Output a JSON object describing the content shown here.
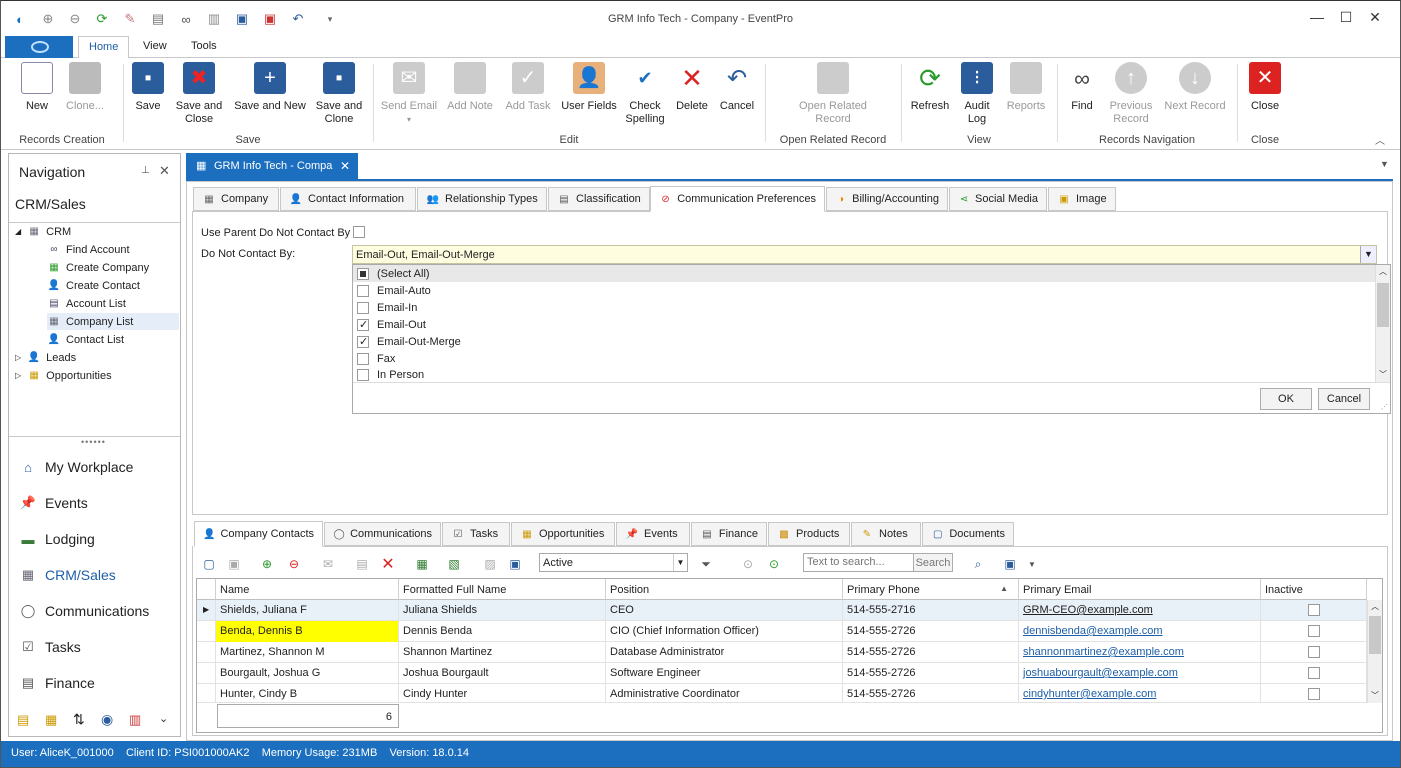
{
  "window": {
    "title": "GRM Info Tech - Company - EventPro"
  },
  "ribbon_tabs": [
    "Home",
    "View",
    "Tools"
  ],
  "ribbon": {
    "buttons": {
      "new": "New",
      "clone": "Clone...",
      "save": "Save",
      "save_close_1": "Save and",
      "save_close_2": "Close",
      "save_new": "Save and New",
      "save_clone_1": "Save and",
      "save_clone_2": "Clone",
      "send_email": "Send Email",
      "add_note": "Add Note",
      "add_task": "Add Task",
      "user_fields": "User Fields",
      "check_spelling_1": "Check",
      "check_spelling_2": "Spelling",
      "delete": "Delete",
      "cancel": "Cancel",
      "open_related_1": "Open Related",
      "open_related_2": "Record",
      "refresh": "Refresh",
      "audit_log_1": "Audit",
      "audit_log_2": "Log",
      "reports": "Reports",
      "find": "Find",
      "previous_1": "Previous",
      "previous_2": "Record",
      "next_record": "Next Record",
      "close": "Close"
    },
    "groups": {
      "records_creation": "Records Creation",
      "save": "Save",
      "edit": "Edit",
      "open_related": "Open Related Record",
      "view": "View",
      "records_navigation": "Records Navigation",
      "close": "Close"
    }
  },
  "navigation": {
    "header": "Navigation",
    "section": "CRM/Sales",
    "tree": {
      "crm": "CRM",
      "items": [
        "Find Account",
        "Create Company",
        "Create Contact",
        "Account List",
        "Company List",
        "Contact List"
      ],
      "leads": "Leads",
      "opportunities": "Opportunities"
    },
    "buttons": [
      "My Workplace",
      "Events",
      "Lodging",
      "CRM/Sales",
      "Communications",
      "Tasks",
      "Finance"
    ]
  },
  "document_tab": {
    "label": "GRM Info Tech - Compa"
  },
  "top_tabs": [
    "Company",
    "Contact Information",
    "Relationship Types",
    "Classification",
    "Communication Preferences",
    "Billing/Accounting",
    "Social Media",
    "Image"
  ],
  "form": {
    "use_parent_label": "Use Parent Do Not Contact By",
    "do_not_contact_label": "Do Not Contact By:",
    "do_not_contact_value": "Email-Out, Email-Out-Merge"
  },
  "dropdown": {
    "options": [
      {
        "label": "(Select All)",
        "state": "partial"
      },
      {
        "label": "Email-Auto",
        "state": "off"
      },
      {
        "label": "Email-In",
        "state": "off"
      },
      {
        "label": "Email-Out",
        "state": "on"
      },
      {
        "label": "Email-Out-Merge",
        "state": "on"
      },
      {
        "label": "Fax",
        "state": "off"
      },
      {
        "label": "In Person",
        "state": "off"
      }
    ],
    "ok": "OK",
    "cancel": "Cancel"
  },
  "bottom_tabs": [
    "Company Contacts",
    "Communications",
    "Tasks",
    "Opportunities",
    "Events",
    "Finance",
    "Products",
    "Notes",
    "Documents"
  ],
  "toolbar": {
    "filter_value": "Active",
    "search_placeholder": "Text to search...",
    "search_button": "Search"
  },
  "grid": {
    "columns": [
      "Name",
      "Formatted Full Name",
      "Position",
      "Primary Phone",
      "Primary Email",
      "Inactive"
    ],
    "rows": [
      {
        "name": "Shields, Juliana F",
        "full": "Juliana Shields",
        "position": "CEO",
        "phone": "514-555-2716",
        "email": "GRM-CEO@example.com"
      },
      {
        "name": "Benda, Dennis B",
        "full": "Dennis Benda",
        "position": "CIO (Chief Information Officer)",
        "phone": "514-555-2726",
        "email": "dennisbenda@example.com"
      },
      {
        "name": "Martinez, Shannon M",
        "full": "Shannon Martinez",
        "position": "Database Administrator",
        "phone": "514-555-2726",
        "email": "shannonmartinez@example.com"
      },
      {
        "name": "Bourgault, Joshua G",
        "full": "Joshua Bourgault",
        "position": "Software Engineer",
        "phone": "514-555-2726",
        "email": "joshuabourgault@example.com"
      },
      {
        "name": "Hunter, Cindy B",
        "full": "Cindy Hunter",
        "position": "Administrative Coordinator",
        "phone": "514-555-2726",
        "email": "cindyhunter@example.com"
      }
    ],
    "footer_count": "6"
  },
  "status_bar": {
    "user": "User: AliceK_001000",
    "client": "Client ID: PSI001000AK2",
    "memory": "Memory Usage: 231MB",
    "version": "Version: 18.0.14"
  }
}
